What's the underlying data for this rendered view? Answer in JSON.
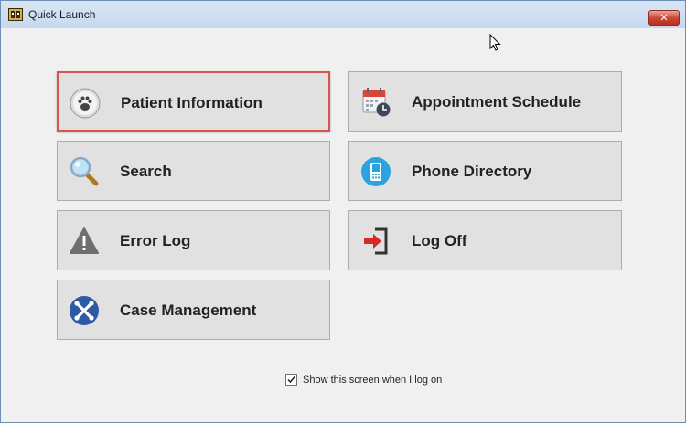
{
  "window": {
    "title": "Quick Launch",
    "close_label": "✕"
  },
  "tiles": [
    {
      "label": "Patient Information",
      "icon": "paw-icon",
      "selected": true
    },
    {
      "label": "Appointment Schedule",
      "icon": "calendar-clock-icon",
      "selected": false
    },
    {
      "label": "Search",
      "icon": "magnifier-icon",
      "selected": false
    },
    {
      "label": "Phone Directory",
      "icon": "mobile-phone-icon",
      "selected": false
    },
    {
      "label": "Error Log",
      "icon": "warning-icon",
      "selected": false
    },
    {
      "label": "Log Off",
      "icon": "log-off-icon",
      "selected": false
    },
    {
      "label": "Case Management",
      "icon": "joomla-icon",
      "selected": false
    }
  ],
  "show_on_logon": {
    "label": "Show this screen when I log on",
    "checked": true
  },
  "colors": {
    "selection_border": "#d9534f",
    "tile_bg": "#e1e1e1",
    "close_red": "#c94534"
  }
}
